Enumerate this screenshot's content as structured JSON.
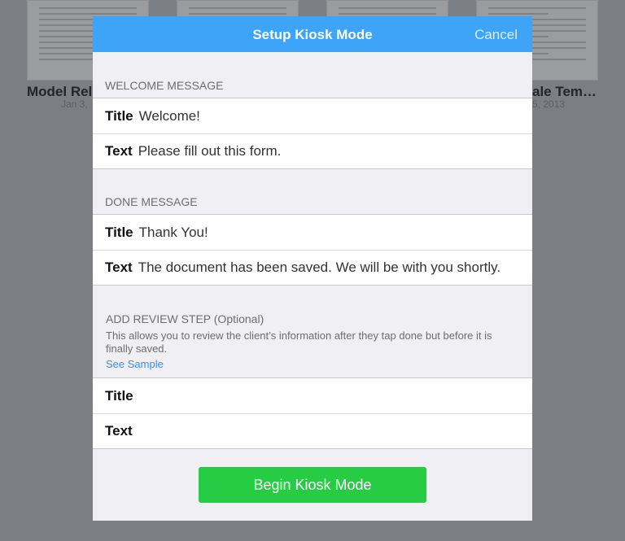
{
  "background_docs": [
    {
      "name": "Model Rel",
      "date": "Jan 3,"
    },
    {
      "name": "",
      "date": ""
    },
    {
      "name": "",
      "date": ""
    },
    {
      "name": "ale Tem…",
      "date": "5, 2013"
    }
  ],
  "modal": {
    "title": "Setup Kiosk Mode",
    "cancel_label": "Cancel",
    "welcome": {
      "header": "WELCOME MESSAGE",
      "title_label": "Title",
      "title_value": "Welcome!",
      "text_label": "Text",
      "text_value": "Please fill out this form."
    },
    "done": {
      "header": "DONE MESSAGE",
      "title_label": "Title",
      "title_value": "Thank You!",
      "text_label": "Text",
      "text_value": "The document has been saved. We will be with you shortly."
    },
    "review": {
      "header": "ADD REVIEW STEP (Optional)",
      "description": "This allows you to review the client’s information after they tap done but before it is finally saved.",
      "sample_link": "See Sample",
      "title_label": "Title",
      "title_value": "",
      "text_label": "Text",
      "text_value": ""
    },
    "begin_button": "Begin Kiosk Mode"
  },
  "colors": {
    "nav_bar": "#3da4f7",
    "primary_button": "#26cc44",
    "link": "#3b8ee8",
    "dim_background": "#7b7e82"
  }
}
